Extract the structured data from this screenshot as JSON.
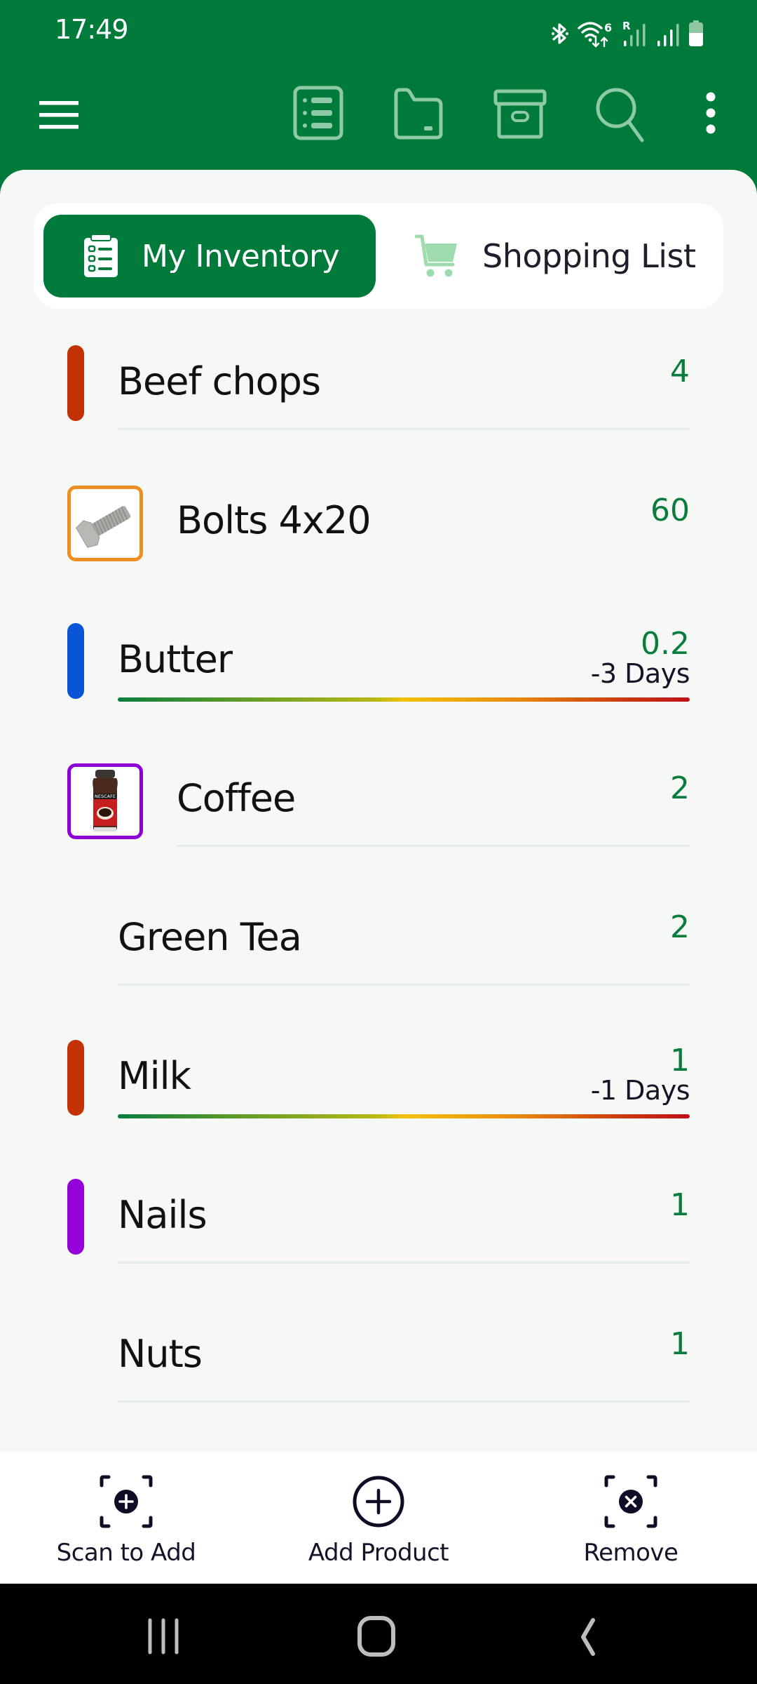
{
  "status_bar": {
    "time": "17:49",
    "icons": [
      "bluetooth-icon",
      "wifi-6-icon",
      "signal-roaming-icon",
      "signal-icon",
      "battery-icon"
    ],
    "wifi_badge": "6",
    "roaming_badge": "R"
  },
  "app_bar": {
    "icons": [
      "menu-icon",
      "list-icon",
      "folder-icon",
      "archive-icon",
      "search-icon",
      "more-vert-icon"
    ]
  },
  "tabs": [
    {
      "label": "My Inventory",
      "icon": "clipboard-list-icon",
      "selected": true
    },
    {
      "label": "Shopping List",
      "icon": "shopping-cart-icon",
      "selected": false
    }
  ],
  "colors": {
    "brand": "#007a3b",
    "quantity": "#0a7d3e",
    "background": "#f5f8f5"
  },
  "items": [
    {
      "name": "Beef chops",
      "quantity": "4",
      "marker": "tag",
      "marker_color": "#c23204"
    },
    {
      "name": "Bolts 4x20",
      "quantity": "60",
      "marker": "thumbnail",
      "thumbnail": "bolt-image",
      "marker_color": "#ee8e1e"
    },
    {
      "name": "Butter",
      "quantity": "0.2",
      "expiry": "-3 Days",
      "marker": "tag",
      "marker_color": "#0a55d6"
    },
    {
      "name": "Coffee",
      "quantity": "2",
      "marker": "thumbnail",
      "thumbnail": "coffee-jar-image",
      "marker_color": "#8f00d6"
    },
    {
      "name": "Green Tea",
      "quantity": "2",
      "marker": "none"
    },
    {
      "name": "Milk",
      "quantity": "1",
      "expiry": "-1 Days",
      "marker": "tag",
      "marker_color": "#c23204"
    },
    {
      "name": "Nails",
      "quantity": "1",
      "marker": "tag",
      "marker_color": "#9300d8"
    },
    {
      "name": "Nuts",
      "quantity": "1",
      "marker": "none"
    }
  ],
  "actions": [
    {
      "label": "Scan to Add",
      "icon": "scan-add-icon"
    },
    {
      "label": "Add Product",
      "icon": "add-circle-icon"
    },
    {
      "label": "Remove",
      "icon": "scan-remove-icon"
    }
  ],
  "nav": [
    "recents-icon",
    "home-icon",
    "back-icon"
  ]
}
